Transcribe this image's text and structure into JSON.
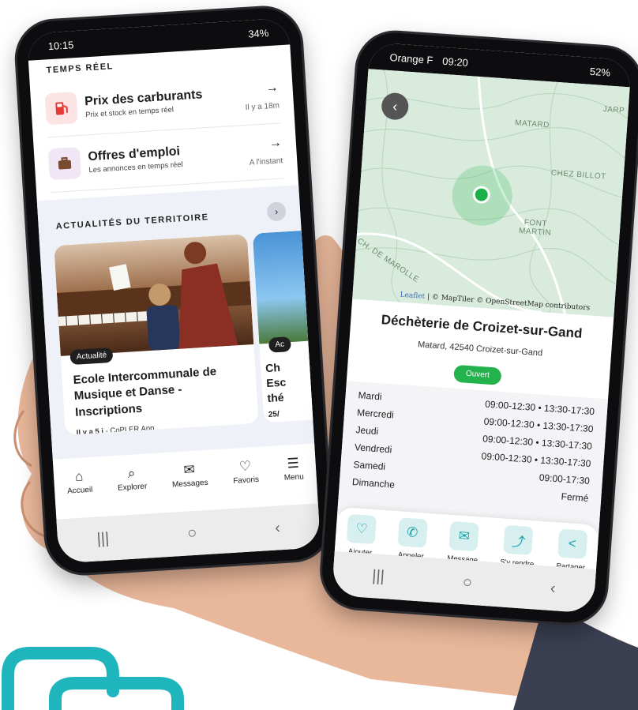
{
  "left_phone": {
    "status": {
      "time": "10:15",
      "right": "34%"
    },
    "realtime": {
      "section_title": "TEMPS RÉEL",
      "items": [
        {
          "title": "Prix des carburants",
          "subtitle": "Prix et stock en temps réel",
          "time": "Il y a 18m",
          "icon": "fuel-pump-icon"
        },
        {
          "title": "Offres d'emploi",
          "subtitle": "Les annonces en temps réel",
          "time": "A l'instant",
          "icon": "briefcase-icon"
        }
      ]
    },
    "news": {
      "section_title": "ACTUALITÉS DU TERRITOIRE",
      "card": {
        "badge": "Actualité",
        "title": "Ecole Intercommunale de Musique et Danse - Inscriptions",
        "age": "Il y a 5 j",
        "source": " - CoPLER App"
      },
      "card2": {
        "badge": "Ac",
        "title": "Ch Esc thé",
        "date": "25/"
      }
    },
    "tabs": [
      {
        "label": "Accueil",
        "icon": "home-icon",
        "glyph": "⌂"
      },
      {
        "label": "Explorer",
        "icon": "search-icon",
        "glyph": "⌕"
      },
      {
        "label": "Messages",
        "icon": "mail-icon",
        "glyph": "✉"
      },
      {
        "label": "Favoris",
        "icon": "heart-icon",
        "glyph": "♡"
      },
      {
        "label": "Menu",
        "icon": "menu-icon",
        "glyph": "☰"
      }
    ],
    "system_nav": [
      "|||",
      "○",
      "‹"
    ]
  },
  "right_phone": {
    "status": {
      "carrier": "Orange F",
      "time": "09:20",
      "right": "52%"
    },
    "map": {
      "labels": [
        "MATARD",
        "CHEZ BILLOT",
        "FONT MARTIN",
        "JARP",
        "CH. DE MAROLLE"
      ],
      "attribution_leaflet": "Leaflet",
      "attribution_rest": " | © MapTiler © OpenStreetMap contributors",
      "marker_color": "#1db04a"
    },
    "place": {
      "title": "Déchèterie de Croizet-sur-Gand",
      "address": "Matard, 42540 Croizet-sur-Gand",
      "status": "Ouvert"
    },
    "hours": [
      {
        "day": "Mardi",
        "time": "09:00-12:30 • 13:30-17:30"
      },
      {
        "day": "Mercredi",
        "time": "09:00-12:30 • 13:30-17:30"
      },
      {
        "day": "Jeudi",
        "time": "09:00-12:30 • 13:30-17:30"
      },
      {
        "day": "Vendredi",
        "time": "09:00-12:30 • 13:30-17:30"
      },
      {
        "day": "Samedi",
        "time": "09:00-17:30"
      },
      {
        "day": "Dimanche",
        "time": "Fermé"
      }
    ],
    "actions": [
      {
        "label": "Ajouter",
        "icon": "heart-icon",
        "glyph": "♡"
      },
      {
        "label": "Appeler",
        "icon": "phone-icon",
        "glyph": "✆"
      },
      {
        "label": "Message",
        "icon": "mail-icon",
        "glyph": "✉"
      },
      {
        "label": "S'y rendre",
        "icon": "route-icon",
        "glyph": "⤴"
      },
      {
        "label": "Partager",
        "icon": "share-icon",
        "glyph": "<"
      }
    ],
    "system_nav": [
      "|||",
      "○",
      "‹"
    ]
  },
  "colors": {
    "accent": "#1aa3a8",
    "open": "#23b24b",
    "logo": "#1fb5bd"
  }
}
